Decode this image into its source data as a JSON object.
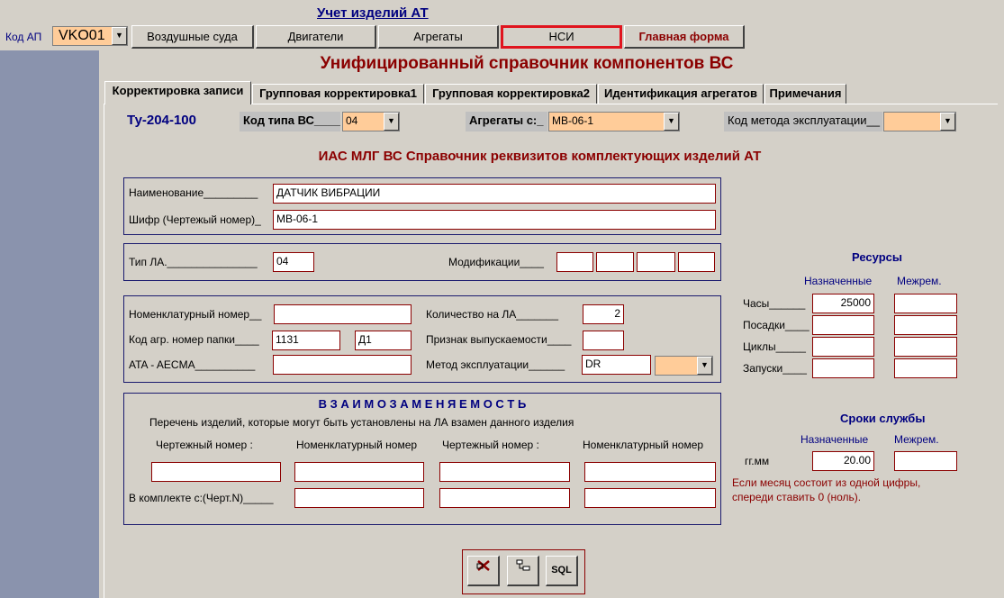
{
  "app": {
    "title": "Учет изделий АТ"
  },
  "top": {
    "kod_label": "Код АП",
    "kod_value": "VKO01"
  },
  "nav": {
    "aircraft": "Воздушные суда",
    "engines": "Двигатели",
    "units": "Агрегаты",
    "nsi": "НСИ",
    "main": "Главная форма"
  },
  "form": {
    "title": "Унифицированный справочник компонентов ВС"
  },
  "tabs": [
    {
      "label": "Корректировка записи"
    },
    {
      "label": "Групповая корректировка1"
    },
    {
      "label": "Групповая корректировка2"
    },
    {
      "label": "Идентификация агрегатов"
    },
    {
      "label": "Примечания"
    }
  ],
  "header": {
    "aircraft_type": "Ту-204-100",
    "type_code_label": "Код типа ВС____",
    "type_code_value": "04",
    "units_from_label": "Агрегаты с:_",
    "units_from_value": "МВ-06-1",
    "method_label": "Код метода эксплуатации__",
    "method_value": ""
  },
  "section_title": "ИАС МЛГ ВС  Справочник  реквизитов  комплектующих  изделий  АТ",
  "ident": {
    "name_label": "Наименование_________",
    "name_value": "ДАТЧИК ВИБРАЦИИ",
    "code_label": "Шифр (Чертежый  номер)_",
    "code_value": "МВ-06-1"
  },
  "type": {
    "la_label": "Тип ЛА._______________",
    "la_value": "04",
    "mods_label": "Модификации____"
  },
  "details": {
    "nomen_label": "Номенклатурный номер__",
    "nomen_value": "",
    "qty_label": "Количество на  ЛА_______",
    "qty_value": "2",
    "folder_label": "Код агр.  номер папки____",
    "folder_value1": "1131",
    "folder_value2": "Д1",
    "release_label": "Признак выпускаемости____",
    "release_value": "",
    "ata_label": "ATA - AECMA__________",
    "ata_value": "",
    "method_label": "Метод эксплуатации______",
    "method_value": "DR"
  },
  "interchange": {
    "title": "В З А И М О З А М Е Н Я Е М О С Т Ь",
    "desc": "Перечень  изделий,  которые  могут  быть  установлены  на  ЛА  взамен  данного  изделия",
    "col1": "Чертежный  номер  :",
    "col2": "Номенклатурный  номер",
    "col3": "Чертежный  номер  :",
    "col4": "Номенклатурный  номер",
    "kit_label": "В  комплекте с:(Черт.N)_____"
  },
  "resources": {
    "title": "Ресурсы",
    "assigned": "Назначенные",
    "between": "Межрем.",
    "hours_label": "Часы______",
    "hours_value": "25000",
    "landings_label": "Посадки____",
    "cycles_label": "Циклы_____",
    "starts_label": "Запуски____"
  },
  "service": {
    "title": "Сроки службы",
    "assigned": "Назначенные",
    "between": "Межрем.",
    "yymm_label": "гг.мм",
    "yymm_value": "20.00",
    "note": "Если месяц состоит из одной цифры, спереди ставить 0 (ноль)."
  },
  "toolbar": {
    "delete_icon": "delete-icon",
    "structure_icon": "tree-icon",
    "sql_label": "SQL"
  }
}
